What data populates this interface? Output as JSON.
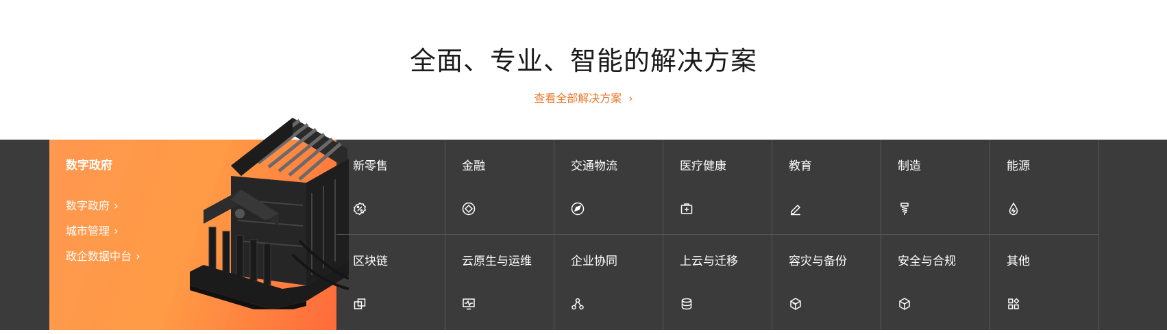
{
  "section": {
    "title": "全面、专业、智能的解决方案",
    "view_all_label": "查看全部解决方案"
  },
  "feature": {
    "title": "数字政府",
    "links": [
      {
        "label": "数字政府"
      },
      {
        "label": "城市管理"
      },
      {
        "label": "政企数据中台"
      }
    ],
    "colors": {
      "gradient_start": "#ff9850",
      "gradient_end": "#ff6b3a"
    }
  },
  "solutions": [
    {
      "label": "新零售",
      "icon": "discount-badge-icon"
    },
    {
      "label": "金融",
      "icon": "diamond-circle-icon"
    },
    {
      "label": "交通物流",
      "icon": "compass-plane-icon"
    },
    {
      "label": "医疗健康",
      "icon": "medical-kit-icon"
    },
    {
      "label": "教育",
      "icon": "pencil-icon"
    },
    {
      "label": "制造",
      "icon": "screw-icon"
    },
    {
      "label": "能源",
      "icon": "water-drop-icon"
    },
    {
      "label": "区块链",
      "icon": "blocks-icon"
    },
    {
      "label": "云原生与运维",
      "icon": "monitor-pulse-icon"
    },
    {
      "label": "企业协同",
      "icon": "nodes-icon"
    },
    {
      "label": "上云与迁移",
      "icon": "database-icon"
    },
    {
      "label": "容灾与备份",
      "icon": "backup-cube-icon"
    },
    {
      "label": "安全与合规",
      "icon": "shield-cube-icon"
    },
    {
      "label": "其他",
      "icon": "apps-grid-icon"
    }
  ],
  "colors": {
    "band_background": "#3b3b3b",
    "accent": "#e87a2e",
    "divider": "#575757"
  }
}
